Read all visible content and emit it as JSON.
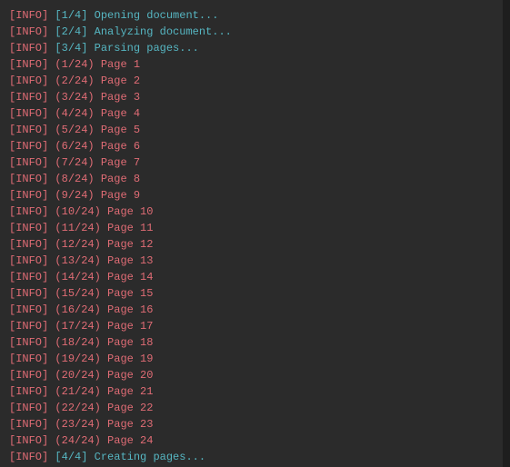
{
  "tag": "[INFO]",
  "steps": {
    "open": {
      "counter": "[1/4]",
      "msg": "Opening document..."
    },
    "analyze": {
      "counter": "[2/4]",
      "msg": "Analyzing document..."
    },
    "parse": {
      "counter": "[3/4]",
      "msg": "Parsing pages..."
    },
    "create": {
      "counter": "[4/4]",
      "msg": "Creating pages..."
    }
  },
  "pages": [
    {
      "counter": "(1/24)",
      "label": "Page 1"
    },
    {
      "counter": "(2/24)",
      "label": "Page 2"
    },
    {
      "counter": "(3/24)",
      "label": "Page 3"
    },
    {
      "counter": "(4/24)",
      "label": "Page 4"
    },
    {
      "counter": "(5/24)",
      "label": "Page 5"
    },
    {
      "counter": "(6/24)",
      "label": "Page 6"
    },
    {
      "counter": "(7/24)",
      "label": "Page 7"
    },
    {
      "counter": "(8/24)",
      "label": "Page 8"
    },
    {
      "counter": "(9/24)",
      "label": "Page 9"
    },
    {
      "counter": "(10/24)",
      "label": "Page 10"
    },
    {
      "counter": "(11/24)",
      "label": "Page 11"
    },
    {
      "counter": "(12/24)",
      "label": "Page 12"
    },
    {
      "counter": "(13/24)",
      "label": "Page 13"
    },
    {
      "counter": "(14/24)",
      "label": "Page 14"
    },
    {
      "counter": "(15/24)",
      "label": "Page 15"
    },
    {
      "counter": "(16/24)",
      "label": "Page 16"
    },
    {
      "counter": "(17/24)",
      "label": "Page 17"
    },
    {
      "counter": "(18/24)",
      "label": "Page 18"
    },
    {
      "counter": "(19/24)",
      "label": "Page 19"
    },
    {
      "counter": "(20/24)",
      "label": "Page 20"
    },
    {
      "counter": "(21/24)",
      "label": "Page 21"
    },
    {
      "counter": "(22/24)",
      "label": "Page 22"
    },
    {
      "counter": "(23/24)",
      "label": "Page 23"
    },
    {
      "counter": "(24/24)",
      "label": "Page 24"
    }
  ]
}
